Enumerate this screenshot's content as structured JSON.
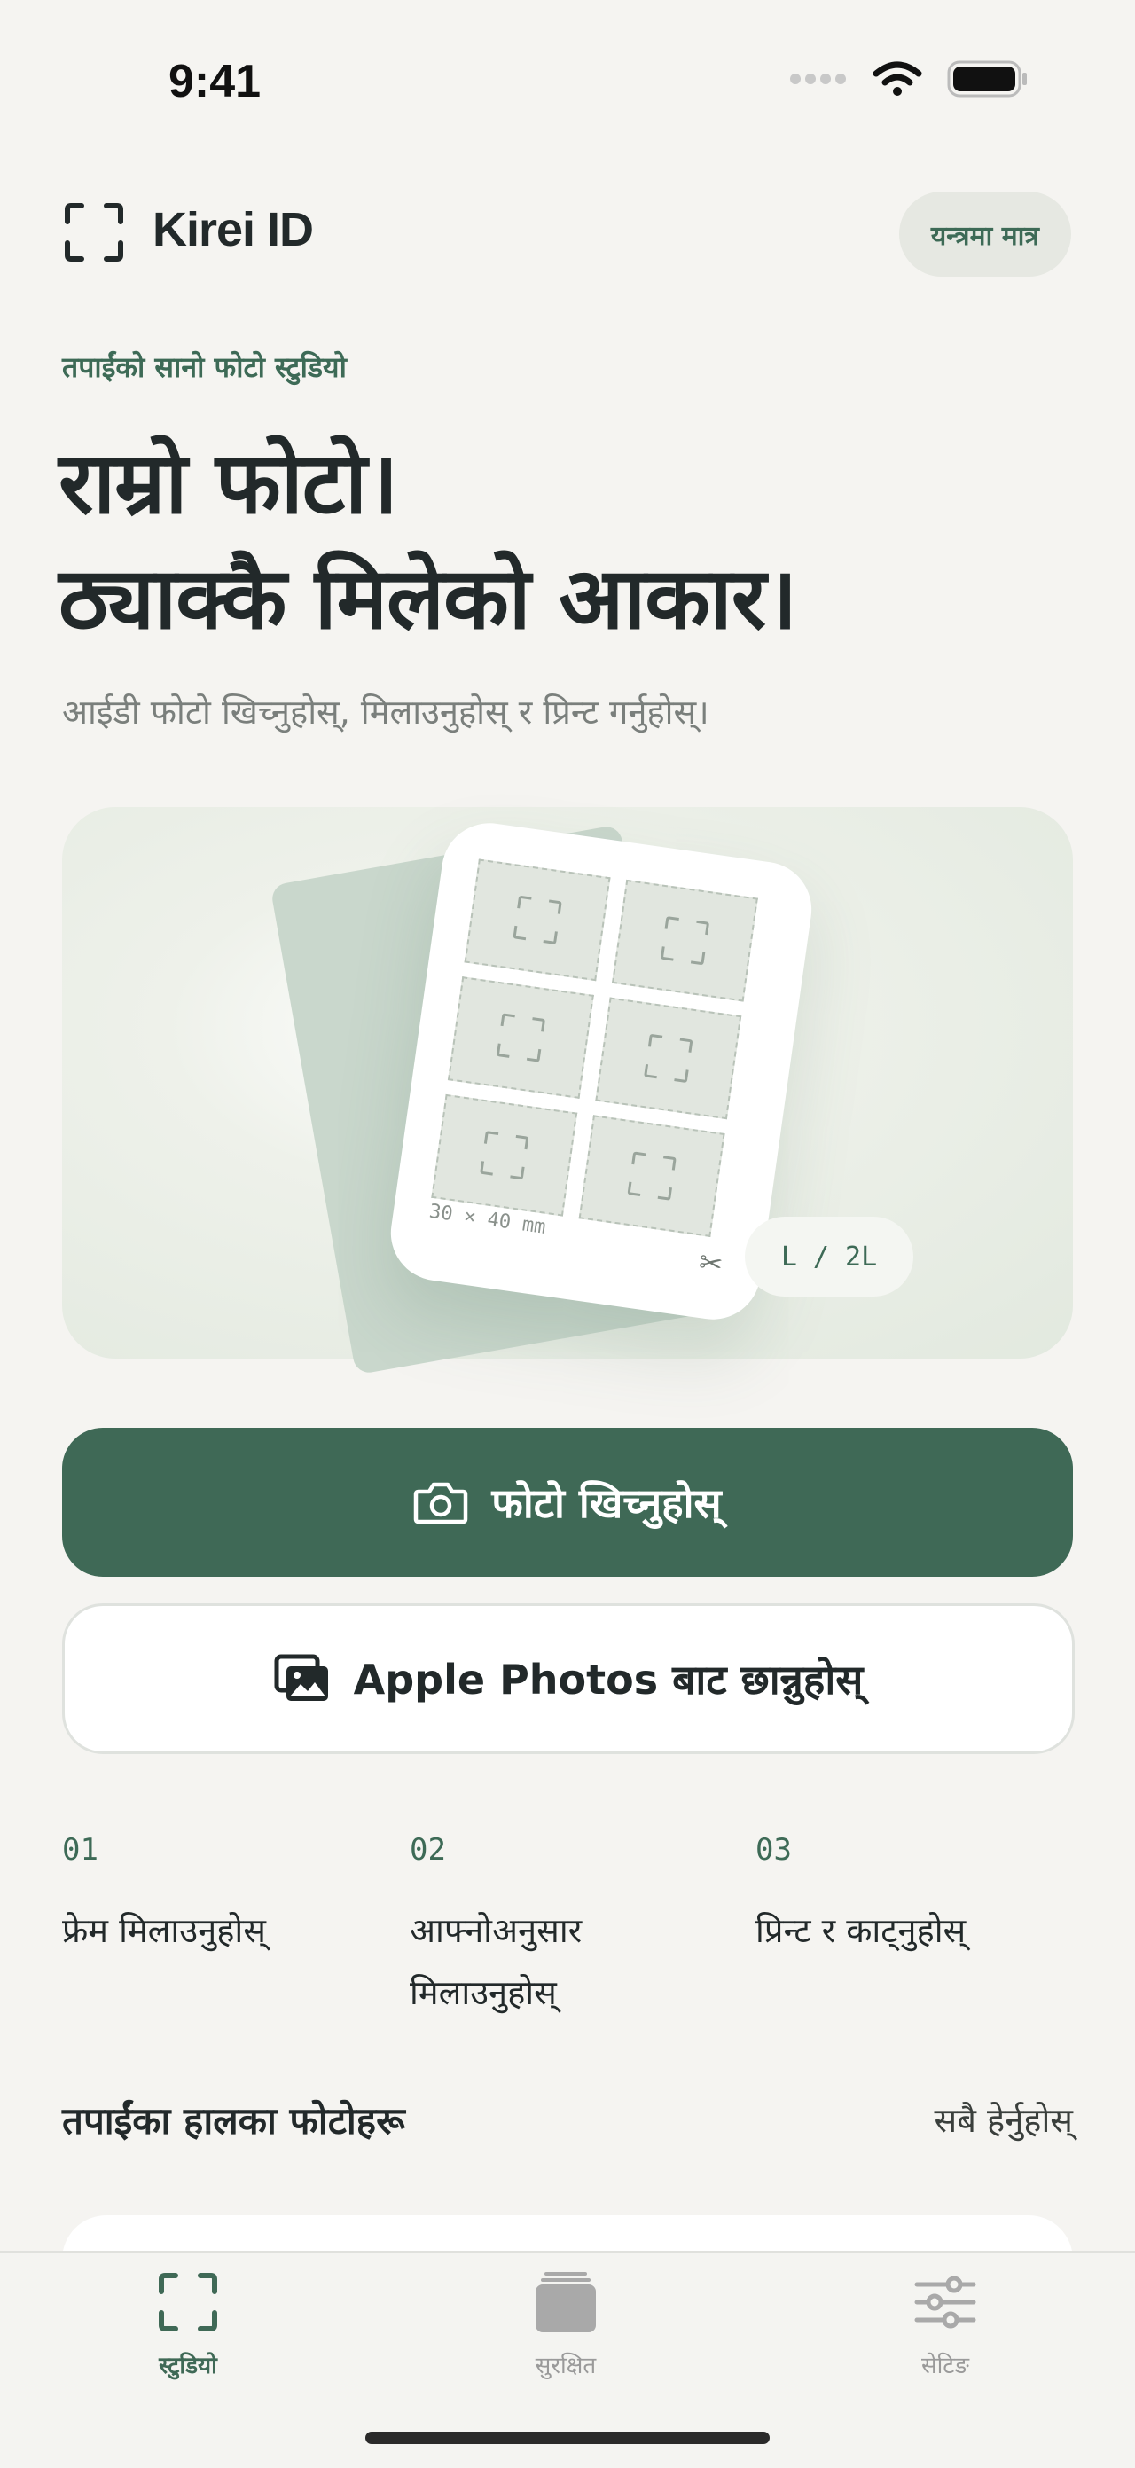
{
  "status_bar": {
    "time": "9:41"
  },
  "header": {
    "app_name": "Kirei ID",
    "device_only_label": "यन्त्रमा मात्र"
  },
  "hero": {
    "eyebrow": "तपाईंको सानो फोटो स्टुडियो",
    "headline_line1": "राम्रो फोटो।",
    "headline_line2": "ठ्याक्कै मिलेको आकार।",
    "subtitle": "आईडी फोटो खिच्नुहोस्, मिलाउनुहोस् र प्रिन्ट गर्नुहोस्।"
  },
  "preview": {
    "size_label": "30 × 40 mm",
    "paper_size": "L / 2L"
  },
  "actions": {
    "take_photo": "फोटो खिच्नुहोस्",
    "choose_photos": "Apple Photos बाट छान्नुहोस्"
  },
  "steps": [
    {
      "num": "01",
      "label": "फ्रेम मिलाउनुहोस्"
    },
    {
      "num": "02",
      "label": "आफ्नोअनुसार मिलाउनुहोस्"
    },
    {
      "num": "03",
      "label": "प्रिन्ट र काट्नुहोस्"
    }
  ],
  "recent": {
    "title": "तपाईंका हालका फोटोहरू",
    "see_all": "सबै हेर्नुहोस्"
  },
  "tabs": [
    {
      "label": "स्टुडियो",
      "icon": "frame-icon",
      "active": true
    },
    {
      "label": "सुरक्षित",
      "icon": "stack-icon",
      "active": false
    },
    {
      "label": "सेटिङ",
      "icon": "sliders-icon",
      "active": false
    }
  ],
  "colors": {
    "accent": "#3f6956",
    "background": "#f5f4f1",
    "text": "#22292a",
    "muted": "#7a7f7c"
  }
}
